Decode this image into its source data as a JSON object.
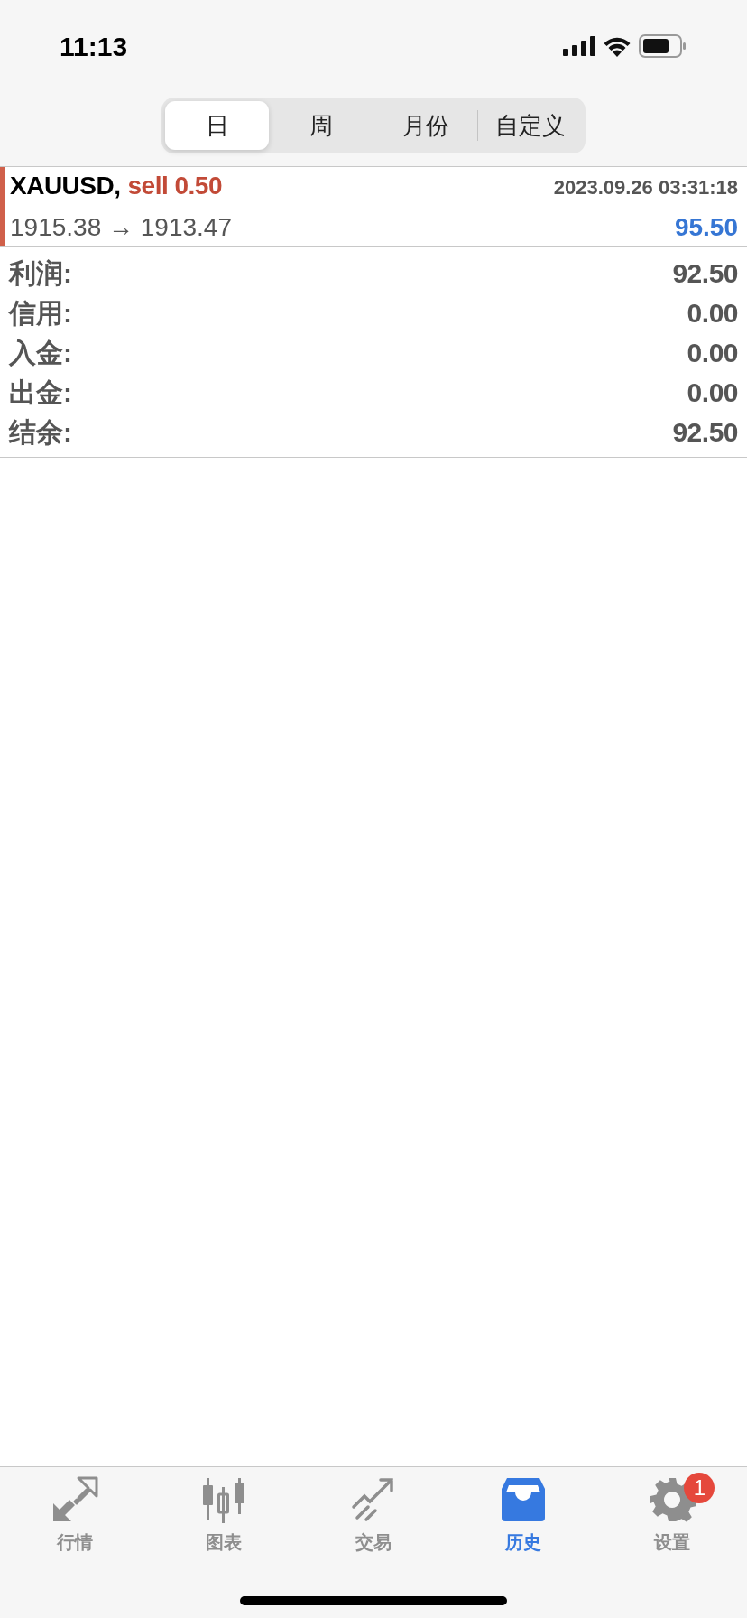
{
  "status_bar": {
    "time": "11:13"
  },
  "periods": [
    {
      "label": "日",
      "selected": true
    },
    {
      "label": "周",
      "selected": false
    },
    {
      "label": "月份",
      "selected": false
    },
    {
      "label": "自定义",
      "selected": false
    }
  ],
  "trades": [
    {
      "symbol": "XAUUSD,",
      "side": "sell 0.50",
      "time": "2023.09.26 03:31:18",
      "prices": "1915.38 → 1913.47",
      "profit": "95.50"
    }
  ],
  "summary": [
    {
      "label": "利润:",
      "value": "92.50"
    },
    {
      "label": "信用:",
      "value": "0.00"
    },
    {
      "label": "入金:",
      "value": "0.00"
    },
    {
      "label": "出金:",
      "value": "0.00"
    },
    {
      "label": "结余:",
      "value": "92.50"
    }
  ],
  "tab_bar": [
    {
      "kind": "quotes",
      "label": "行情",
      "selected": false
    },
    {
      "kind": "chart",
      "label": "图表",
      "selected": false
    },
    {
      "kind": "trade",
      "label": "交易",
      "selected": false
    },
    {
      "kind": "history",
      "label": "历史",
      "selected": true
    },
    {
      "kind": "settings",
      "label": "设置",
      "selected": false,
      "badge": "1"
    }
  ]
}
